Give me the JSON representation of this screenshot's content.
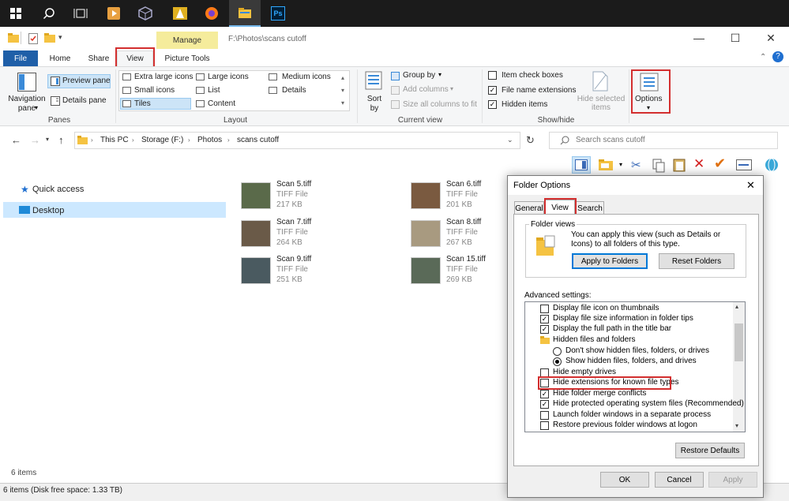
{
  "taskbar": {
    "icons": [
      "windows-start-icon",
      "search-icon",
      "task-view-icon",
      "media-player-icon",
      "virtualbox-icon",
      "vlc-icon",
      "firefox-icon",
      "file-explorer-icon",
      "photoshop-icon"
    ],
    "photoshop_label": "Ps"
  },
  "explorer": {
    "title_path": "F:\\Photos\\scans cutoff",
    "manage_label": "Manage",
    "tabs": [
      "File",
      "Home",
      "Share",
      "View",
      "Picture Tools"
    ],
    "ribbon": {
      "panes": {
        "group_label": "Panes",
        "navigation_pane": "Navigation pane",
        "preview_pane": "Preview pane",
        "details_pane": "Details pane"
      },
      "layout": {
        "group_label": "Layout",
        "items": [
          "Extra large icons",
          "Large icons",
          "Medium icons",
          "Small icons",
          "List",
          "Details",
          "Tiles",
          "Content"
        ]
      },
      "current_view": {
        "group_label": "Current view",
        "sort_by": "Sort by",
        "group_by": "Group by",
        "add_columns": "Add columns",
        "size_all_columns": "Size all columns to fit"
      },
      "show_hide": {
        "group_label": "Show/hide",
        "item_check_boxes": "Item check boxes",
        "file_name_extensions": "File name extensions",
        "hidden_items": "Hidden items",
        "hide_selected_items": "Hide selected items",
        "checks": {
          "item_check_boxes": false,
          "file_name_extensions": true,
          "hidden_items": true
        }
      },
      "options_label": "Options"
    },
    "address": {
      "crumbs": [
        "This PC",
        "Storage (F:)",
        "Photos",
        "scans cutoff"
      ],
      "search_placeholder": "Search scans cutoff"
    },
    "nav": {
      "quick_access": "Quick access",
      "desktop": "Desktop"
    },
    "files": [
      {
        "name": "Scan 5.tiff",
        "type": "TIFF File",
        "size": "217 KB",
        "thumb": "#5a6a4a"
      },
      {
        "name": "Scan 6.tiff",
        "type": "TIFF File",
        "size": "201 KB",
        "thumb": "#7a5a40"
      },
      {
        "name": "Scan 7.tiff",
        "type": "TIFF File",
        "size": "264 KB",
        "thumb": "#6a5a48"
      },
      {
        "name": "Scan 8.tiff",
        "type": "TIFF File",
        "size": "267 KB",
        "thumb": "#a89a80"
      },
      {
        "name": "Scan 9.tiff",
        "type": "TIFF File",
        "size": "251 KB",
        "thumb": "#4a5a60"
      },
      {
        "name": "Scan 15.tiff",
        "type": "TIFF File",
        "size": "269 KB",
        "thumb": "#5a6a58"
      }
    ],
    "item_count": "6 items",
    "status": "6 items (Disk free space: 1.33 TB)"
  },
  "dialog": {
    "title": "Folder Options",
    "tabs": [
      "General",
      "View",
      "Search"
    ],
    "folder_views_label": "Folder views",
    "folder_views_text": "You can apply this view (such as Details or Icons) to all folders of this type.",
    "apply_button": "Apply to Folders",
    "reset_button": "Reset Folders",
    "advanced_label": "Advanced settings:",
    "settings": [
      {
        "kind": "check",
        "label": "Display file icon on thumbnails",
        "checked": false
      },
      {
        "kind": "check",
        "label": "Display file size information in folder tips",
        "checked": true
      },
      {
        "kind": "check",
        "label": "Display the full path in the title bar",
        "checked": true
      },
      {
        "kind": "folder",
        "label": "Hidden files and folders"
      },
      {
        "kind": "radio",
        "label": "Don't show hidden files, folders, or drives",
        "checked": false
      },
      {
        "kind": "radio",
        "label": "Show hidden files, folders, and drives",
        "checked": true
      },
      {
        "kind": "check",
        "label": "Hide empty drives",
        "checked": false
      },
      {
        "kind": "check",
        "label": "Hide extensions for known file types",
        "checked": false
      },
      {
        "kind": "check",
        "label": "Hide folder merge conflicts",
        "checked": true
      },
      {
        "kind": "check",
        "label": "Hide protected operating system files (Recommended)",
        "checked": true
      },
      {
        "kind": "check",
        "label": "Launch folder windows in a separate process",
        "checked": false
      },
      {
        "kind": "check",
        "label": "Restore previous folder windows at logon",
        "checked": false
      }
    ],
    "restore_defaults": "Restore Defaults",
    "ok": "OK",
    "cancel": "Cancel",
    "apply": "Apply"
  }
}
